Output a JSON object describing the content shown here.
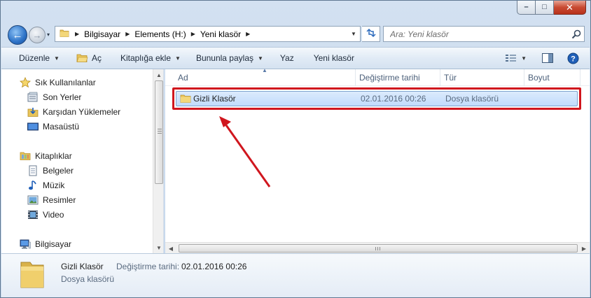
{
  "window": {
    "minimize_label": "–",
    "maximize_label": "□",
    "close_label": "✕"
  },
  "navigation": {
    "back_label": "←",
    "forward_label": "→",
    "history_label": "▾"
  },
  "address_bar": {
    "crumbs": [
      "Bilgisayar",
      "Elements (H:)",
      "Yeni klasör"
    ]
  },
  "search": {
    "placeholder": "Ara: Yeni klasör"
  },
  "toolbar": {
    "organize": "Düzenle",
    "open": "Aç",
    "include_in_library": "Kitaplığa ekle",
    "share_with": "Bununla paylaş",
    "burn": "Yaz",
    "new_folder": "Yeni klasör"
  },
  "sidebar": {
    "favorites": {
      "title": "Sık Kullanılanlar",
      "items": [
        "Son Yerler",
        "Karşıdan Yüklemeler",
        "Masaüstü"
      ]
    },
    "libraries": {
      "title": "Kitaplıklar",
      "items": [
        "Belgeler",
        "Müzik",
        "Resimler",
        "Video"
      ]
    },
    "computer": {
      "title": "Bilgisayar"
    }
  },
  "file_list": {
    "columns": [
      "Ad",
      "Değiştirme tarihi",
      "Tür",
      "Boyut"
    ],
    "rows": [
      {
        "name": "Gizli Klasör",
        "modified": "02.01.2016 00:26",
        "type": "Dosya klasörü",
        "size": ""
      }
    ]
  },
  "details_pane": {
    "name": "Gizli Klasör",
    "modified_label": "Değiştirme tarihi:",
    "modified_value": "02.01.2016 00:26",
    "type": "Dosya klasörü"
  },
  "colors": {
    "highlight_border": "#d0161e",
    "selection_fill": "#c1dbfc",
    "annotation_arrow": "#d0161e"
  },
  "icons": [
    "folder-icon",
    "star-icon",
    "recent-places-icon",
    "downloads-icon",
    "desktop-icon",
    "library-icon",
    "documents-icon",
    "music-icon",
    "pictures-icon",
    "video-icon",
    "computer-icon",
    "search-icon",
    "refresh-icon",
    "views-icon",
    "preview-pane-icon",
    "help-icon"
  ]
}
